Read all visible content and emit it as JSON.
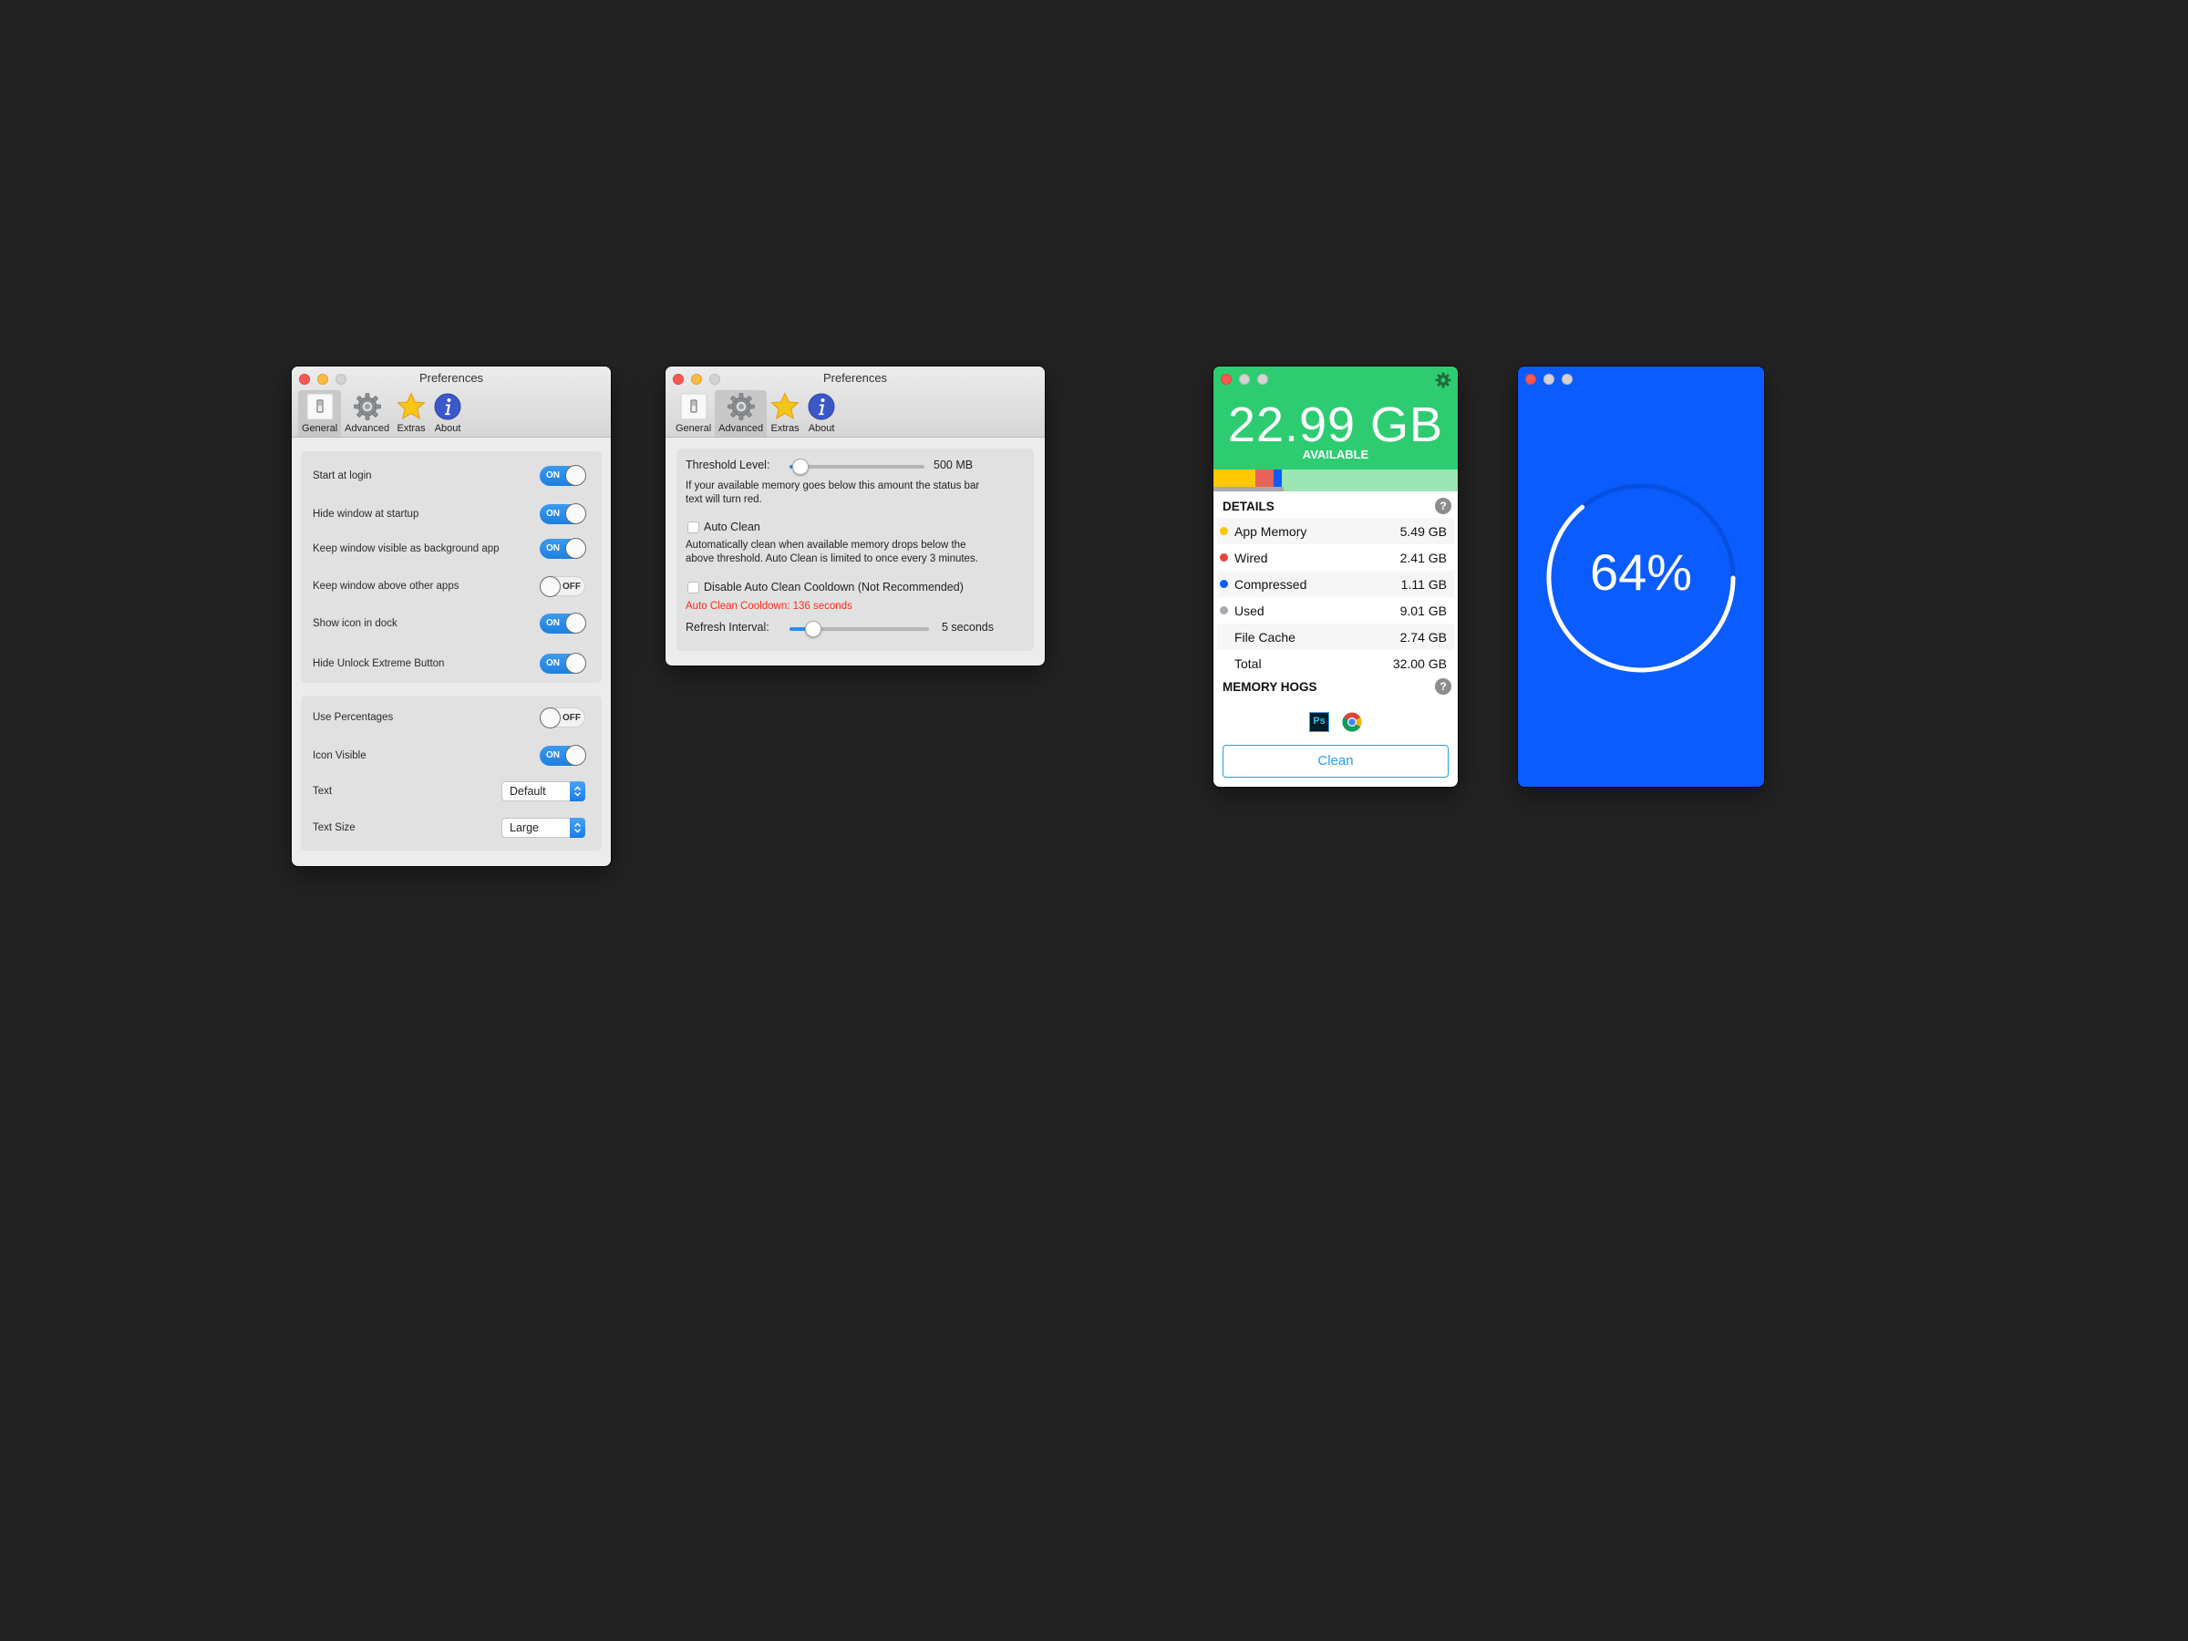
{
  "desktop": {
    "background": "#232323"
  },
  "prefs_general": {
    "title": "Preferences",
    "tabs": [
      {
        "label": "General",
        "icon": "switch-icon",
        "active": true
      },
      {
        "label": "Advanced",
        "icon": "gear-icon",
        "active": false
      },
      {
        "label": "Extras",
        "icon": "star-icon",
        "active": false
      },
      {
        "label": "About",
        "icon": "info-icon",
        "active": false
      }
    ],
    "group1": [
      {
        "label": "Start at login",
        "state": "ON"
      },
      {
        "label": "Hide window at startup",
        "state": "ON"
      },
      {
        "label": "Keep window visible as background app",
        "state": "ON"
      },
      {
        "label": "Keep window above other apps",
        "state": "OFF"
      },
      {
        "label": "Show icon in dock",
        "state": "ON"
      },
      {
        "label": "Hide Unlock Extreme Button",
        "state": "ON"
      }
    ],
    "group2": {
      "use_percentages": {
        "label": "Use Percentages",
        "state": "OFF"
      },
      "icon_visible": {
        "label": "Icon Visible",
        "state": "ON"
      },
      "text": {
        "label": "Text",
        "value": "Default"
      },
      "text_size": {
        "label": "Text Size",
        "value": "Large"
      }
    }
  },
  "prefs_advanced": {
    "title": "Preferences",
    "tabs": [
      {
        "label": "General",
        "icon": "switch-icon",
        "active": false
      },
      {
        "label": "Advanced",
        "icon": "gear-icon",
        "active": true
      },
      {
        "label": "Extras",
        "icon": "star-icon",
        "active": false
      },
      {
        "label": "About",
        "icon": "info-icon",
        "active": false
      }
    ],
    "threshold": {
      "label": "Threshold Level:",
      "value": "500 MB",
      "slider_fraction": 0.08
    },
    "threshold_desc_1": "If your available memory goes below this amount the status bar",
    "threshold_desc_2": "text will turn red.",
    "auto_clean": {
      "label": "Auto Clean",
      "checked": false
    },
    "auto_clean_desc_1": "Automatically clean when available memory drops below the",
    "auto_clean_desc_2": "above threshold. Auto Clean is limited to once every 3 minutes.",
    "disable_cooldown": {
      "label": "Disable Auto Clean Cooldown (Not Recommended)",
      "checked": false
    },
    "cooldown_status": "Auto Clean Cooldown: 136 seconds",
    "cooldown_color": "#ff2a1a",
    "refresh": {
      "label": "Refresh Interval:",
      "value": "5 seconds",
      "slider_fraction": 0.17
    }
  },
  "memory_window": {
    "available": "22.99 GB",
    "available_label": "AVAILABLE",
    "accent": "#2ecc71",
    "bar_segments": [
      {
        "name": "App Memory",
        "fraction": 0.1716,
        "color": "#ffc800"
      },
      {
        "name": "Wired",
        "fraction": 0.0753,
        "color": "#e8635a"
      },
      {
        "name": "Compressed",
        "fraction": 0.0347,
        "color": "#0a5cff"
      }
    ],
    "details_title": "DETAILS",
    "details": [
      {
        "label": "App Memory",
        "value": "5.49 GB",
        "color": "#ffc800"
      },
      {
        "label": "Wired",
        "value": "2.41 GB",
        "color": "#e8423a"
      },
      {
        "label": "Compressed",
        "value": "1.11 GB",
        "color": "#0a5cff"
      },
      {
        "label": "Used",
        "value": "9.01 GB",
        "color": "#a9a9b0"
      },
      {
        "label": "File Cache",
        "value": "2.74 GB",
        "color": null
      },
      {
        "label": "Total",
        "value": "32.00 GB",
        "color": null
      }
    ],
    "hogs_title": "MEMORY HOGS",
    "hogs": [
      {
        "name": "Photoshop",
        "icon": "photoshop-icon",
        "text": "Ps"
      },
      {
        "name": "Chrome",
        "icon": "chrome-icon"
      }
    ],
    "help_glyph": "?",
    "clean_label": "Clean"
  },
  "percent_window": {
    "value_text": "64%",
    "percent": 64,
    "background": "#0a5cff"
  }
}
